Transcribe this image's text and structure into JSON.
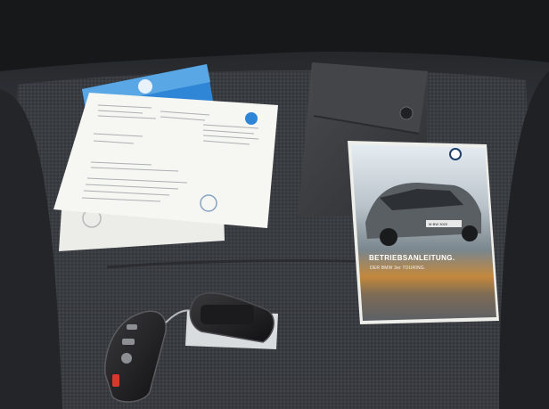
{
  "scene": {
    "description_free": true,
    "palette": {
      "seat_dark": "#2b2d31",
      "seat_mid": "#3b3e43",
      "paper": "#f4f4f0",
      "blue_booklet": "#2f86d6",
      "wallet": "#3a3b3e",
      "cover_top": "#dfe7ee",
      "cover_bottom": "#7d8a92",
      "key_black": "#1c1c1e"
    }
  },
  "manual": {
    "title": "BETRIEBSANLEITUNG.",
    "subtitle": "DER BMW 3er TOURING.",
    "plate": "M·BW 3020"
  },
  "icons": {
    "bmw_roundel_manual": "bmw-logo-icon",
    "bmw_roundel_wallet": "bmw-logo-icon",
    "key_button_lock": "lock-icon",
    "key_button_unlock": "unlock-icon",
    "key_button_trunk": "trunk-icon"
  }
}
